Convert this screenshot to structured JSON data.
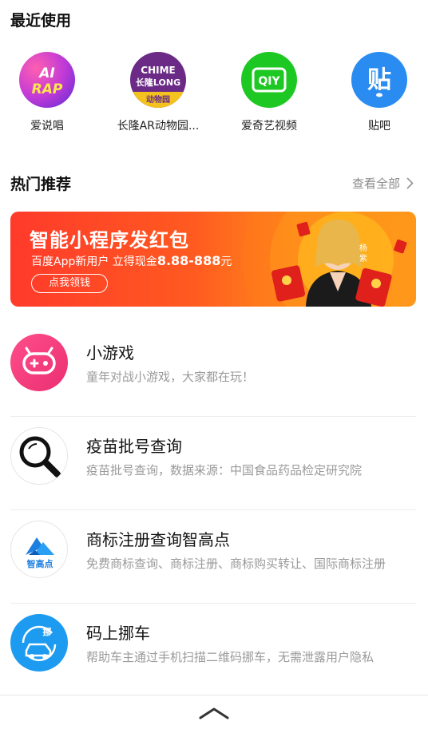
{
  "recent": {
    "title": "最近使用",
    "items": [
      {
        "label": "爱说唱",
        "icon": "ai-rap-logo-icon",
        "icon_text": "AI RAP"
      },
      {
        "label": "长隆AR动物园...",
        "icon": "chimelong-logo-icon",
        "icon_text_top": "CHIME",
        "icon_text_mid": "长隆LONG",
        "icon_text_bottom": "动物园"
      },
      {
        "label": "爱奇艺视频",
        "icon": "iqiyi-logo-icon",
        "icon_text": "iQIYI"
      },
      {
        "label": "贴吧",
        "icon": "tieba-logo-icon",
        "icon_text": "贴"
      }
    ]
  },
  "hot": {
    "title": "热门推荐",
    "view_all": "查看全部"
  },
  "banner": {
    "title": "智能小程序发红包",
    "sub_prefix": "百度App新用户  立得现金",
    "sub_amount": "8.88-888",
    "sub_suffix": "元",
    "button": "点我领钱",
    "person_name": "杨紫"
  },
  "list": [
    {
      "title": "小游戏",
      "desc": "童年对战小游戏，大家都在玩！",
      "icon": "gamepad-icon"
    },
    {
      "title": "疫苗批号查询",
      "desc": "疫苗批号查询，数据来源：中国食品药品检定研究院",
      "icon": "magnifier-icon"
    },
    {
      "title": "商标注册查询智高点",
      "desc": "免费商标查询、商标注册、商标购买转让、国际商标注册",
      "icon": "zhigaodian-logo-icon",
      "icon_text": "智高点"
    },
    {
      "title": "码上挪车",
      "desc": "帮助车主通过手机扫描二维码挪车，无需泄露用户隐私",
      "icon": "car-move-icon",
      "icon_text": "挪"
    }
  ],
  "colors": {
    "banner_start": "#ff3a2b",
    "banner_end": "#ffb01a",
    "iqiyi_green": "#1ec822",
    "tieba_blue": "#2a8cf0",
    "game_pink": "#f0407a",
    "car_blue": "#1d9bf0"
  }
}
